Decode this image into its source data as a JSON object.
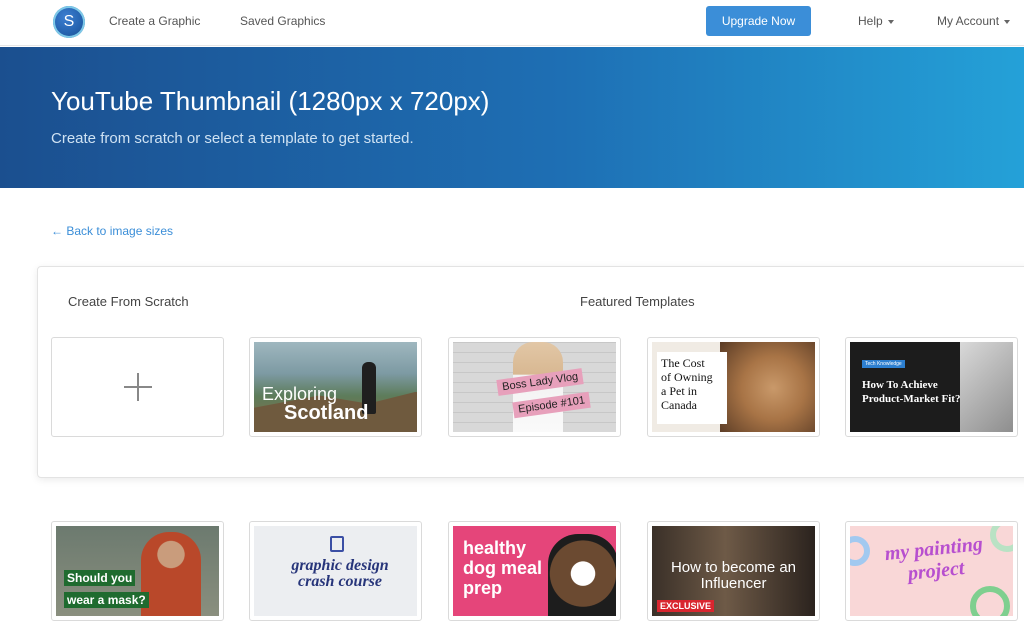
{
  "nav": {
    "logo_letter": "S",
    "links": [
      "Create a Graphic",
      "Saved Graphics"
    ],
    "upgrade_label": "Upgrade Now",
    "help_label": "Help",
    "account_label": "My Account"
  },
  "hero": {
    "title": "YouTube Thumbnail (1280px x 720px)",
    "subtitle": "Create from scratch or select a template to get started."
  },
  "back_link": "← Back to image sizes",
  "card": {
    "scratch_heading": "Create From Scratch",
    "featured_heading": "Featured Templates"
  },
  "templates": {
    "scotland": {
      "line1": "Exploring",
      "line2": "Scotland"
    },
    "vlog": {
      "line1": "Boss Lady Vlog",
      "line2": "Episode #101"
    },
    "pet": {
      "lines": [
        "The Cost",
        "of Owning",
        "a Pet in",
        "Canada"
      ]
    },
    "tech": {
      "tag": "Tech Knowledge",
      "heading": "How To Achieve Product-Market Fit?"
    },
    "mask": {
      "line1": "Should you",
      "line2": "wear a mask?"
    },
    "design": {
      "text": "graphic design crash course"
    },
    "dog_meal": {
      "text": "healthy dog meal prep"
    },
    "influencer": {
      "text": "How to become an Influencer",
      "badge": "EXCLUSIVE"
    },
    "painting": {
      "text": "my painting project"
    }
  },
  "colors": {
    "accent": "#3b8ed8",
    "hero_start": "#1b4f8f",
    "hero_end": "#24a1d8"
  }
}
